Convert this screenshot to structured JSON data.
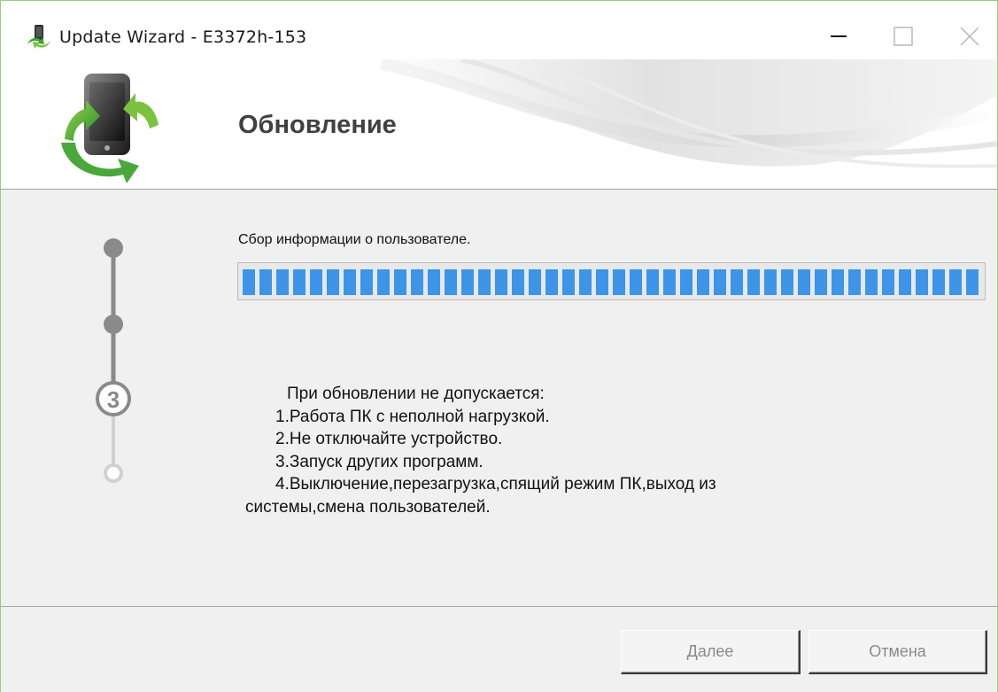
{
  "window": {
    "title": "Update Wizard - E3372h-153",
    "icons": {
      "app": "phone-update-icon",
      "minimize": "minimize-icon",
      "maximize": "maximize-icon",
      "close": "close-icon"
    }
  },
  "header": {
    "title": "Обновление",
    "logo": "phone-refresh-logo"
  },
  "stepper": {
    "current_step": "3",
    "total_steps": 4
  },
  "progress": {
    "label": "Сбор информации о пользователе.",
    "value": 1.0
  },
  "warnings": {
    "heading": "При обновлении не допускается:",
    "items": [
      "1.Работа ПК с неполной нагрузкой.",
      "2.Не отключайте устройство.",
      "3.Запуск других программ.",
      "4.Выключение,перезагрузка,спящий режим ПК,выход из"
    ],
    "item4_continuation": "системы,смена пользователей."
  },
  "buttons": {
    "next": "Далее",
    "cancel": "Отмена"
  },
  "colors": {
    "progress": "#3c95e8",
    "step_active": "#8a8a8a",
    "step_future": "#d0d0d0",
    "window_border": "#9acd7a"
  }
}
